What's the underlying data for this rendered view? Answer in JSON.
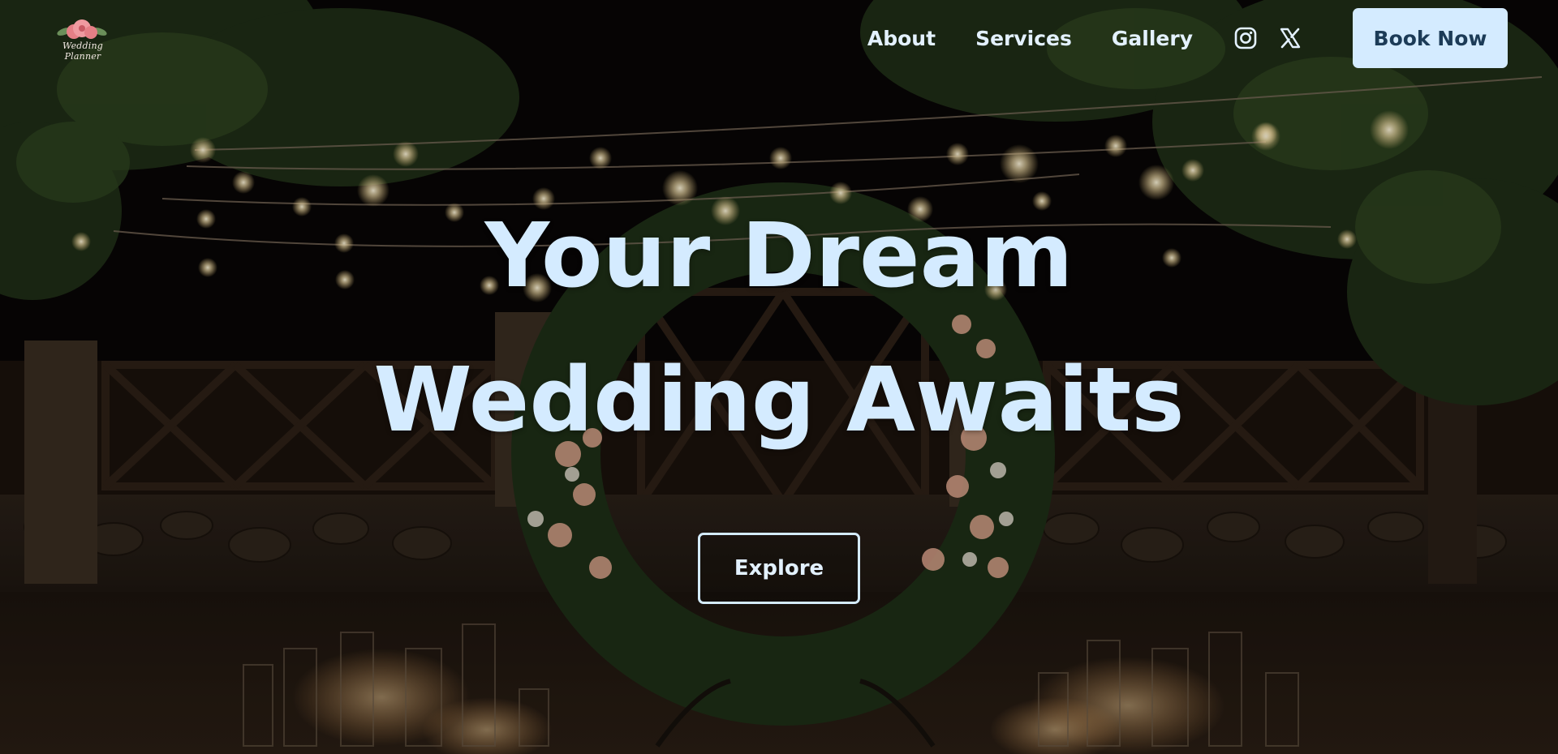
{
  "brand": {
    "logo_text": "Wedding Planner",
    "logo_icon": "flower-icon"
  },
  "nav": {
    "links": [
      {
        "label": "About"
      },
      {
        "label": "Services"
      },
      {
        "label": "Gallery"
      }
    ],
    "social": [
      {
        "name": "instagram-icon"
      },
      {
        "name": "x-icon"
      }
    ],
    "cta_label": "Book Now"
  },
  "hero": {
    "headline_line1": "Your Dream",
    "headline_line2": "Wedding Awaits",
    "explore_label": "Explore",
    "background": "night-wedding-venue-photo"
  },
  "colors": {
    "accent": "#d4ebff",
    "cta_text": "#1c3b57",
    "nav_text": "#e3f1ff"
  }
}
